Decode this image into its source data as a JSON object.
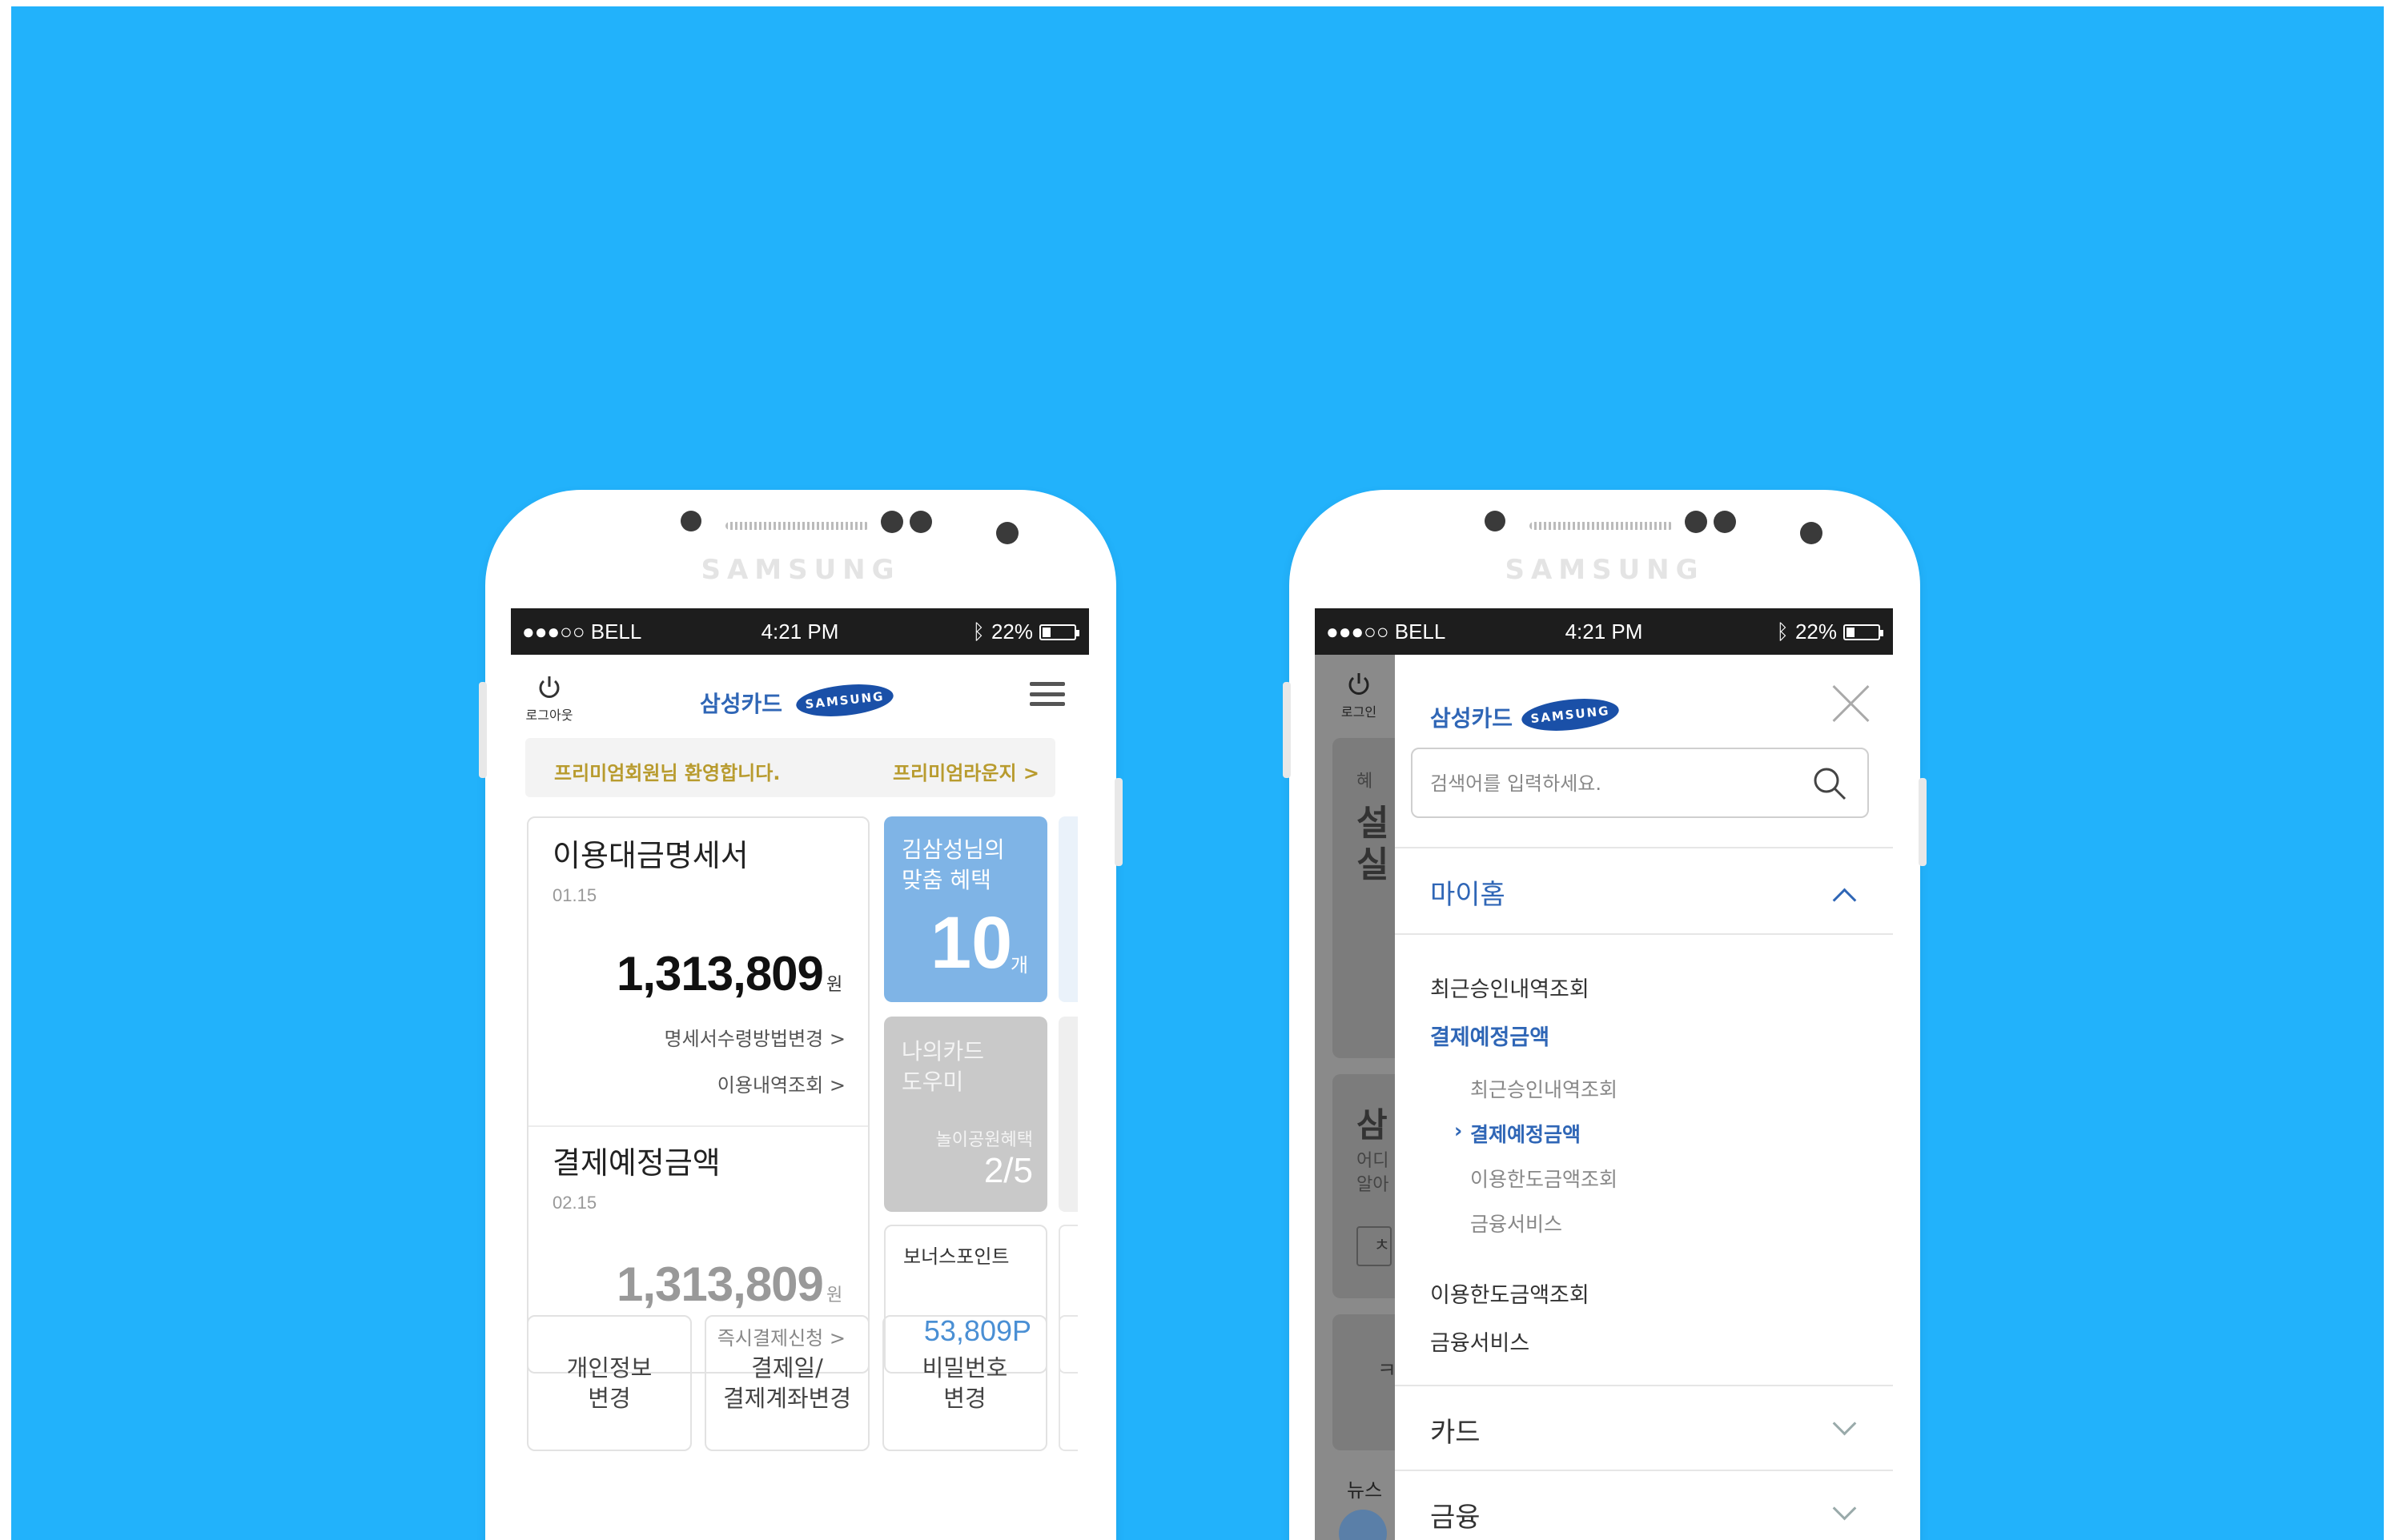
{
  "status_bar": {
    "carrier": "●●●○○ BELL",
    "time": "4:21 PM",
    "bluetooth": "bluetooth-icon",
    "battery": "22%"
  },
  "phone_brand": "SAMSUNG",
  "left_screen": {
    "header": {
      "power_label": "로그아웃",
      "logo_text": "삼성카드",
      "logo_badge": "SAMSUNG"
    },
    "welcome": {
      "message": "프리미엄회원님 환영합니다.",
      "link": "프리미엄라운지 >"
    },
    "statement": {
      "title": "이용대금명세서",
      "date": "01.15",
      "amount": "1,313,809",
      "unit": "원",
      "link1": "명세서수령방법변경 >",
      "link2": "이용내역조회 >"
    },
    "payment": {
      "title": "결제예정금액",
      "date": "02.15",
      "amount": "1,313,809",
      "unit": "원",
      "link": "즉시결제신청 >"
    },
    "benefit_tile": {
      "line1": "김삼성님의",
      "line2": "맞춤 혜택",
      "count": "10",
      "unit": "개"
    },
    "helper_tile": {
      "line1": "나의카드",
      "line2": "도우미",
      "sub": "놀이공원혜택",
      "progress_text": "2/5"
    },
    "bonus_tile": {
      "label": "보너스포인트",
      "value": "53,809P"
    },
    "buttons": [
      {
        "line1": "개인정보",
        "line2": "변경"
      },
      {
        "line1": "결제일/",
        "line2": "결제계좌변경"
      },
      {
        "line1": "비밀번호",
        "line2": "변경"
      }
    ]
  },
  "right_screen": {
    "bg_power_label": "로그인",
    "bg_peek": {
      "p1": "혜",
      "p2": "설",
      "p3": "실",
      "p4": "삼",
      "p5": "어디",
      "p6": "알아",
      "p7": "ㅊ",
      "p8": "ㅋ",
      "p9": "뉴스"
    },
    "drawer": {
      "logo_text": "삼성카드",
      "logo_badge": "SAMSUNG",
      "search_placeholder": "검색어를 입력하세요.",
      "section_myhome": "마이홈",
      "items": [
        "최근승인내역조회",
        "결제예정금액"
      ],
      "subitems": [
        "최근승인내역조회",
        "결제예정금액",
        "이용한도금액조회",
        "금융서비스"
      ],
      "items_after": [
        "이용한도금액조회",
        "금융서비스"
      ],
      "section_card": "카드",
      "section_finance": "금융"
    }
  },
  "colors": {
    "background": "#22b2fb",
    "accent_blue": "#2f66b6",
    "gold": "#b89b2e",
    "tile_blue": "#7fb4e6",
    "tile_gray": "#c9c9c9",
    "point_blue": "#4a8fd4"
  }
}
